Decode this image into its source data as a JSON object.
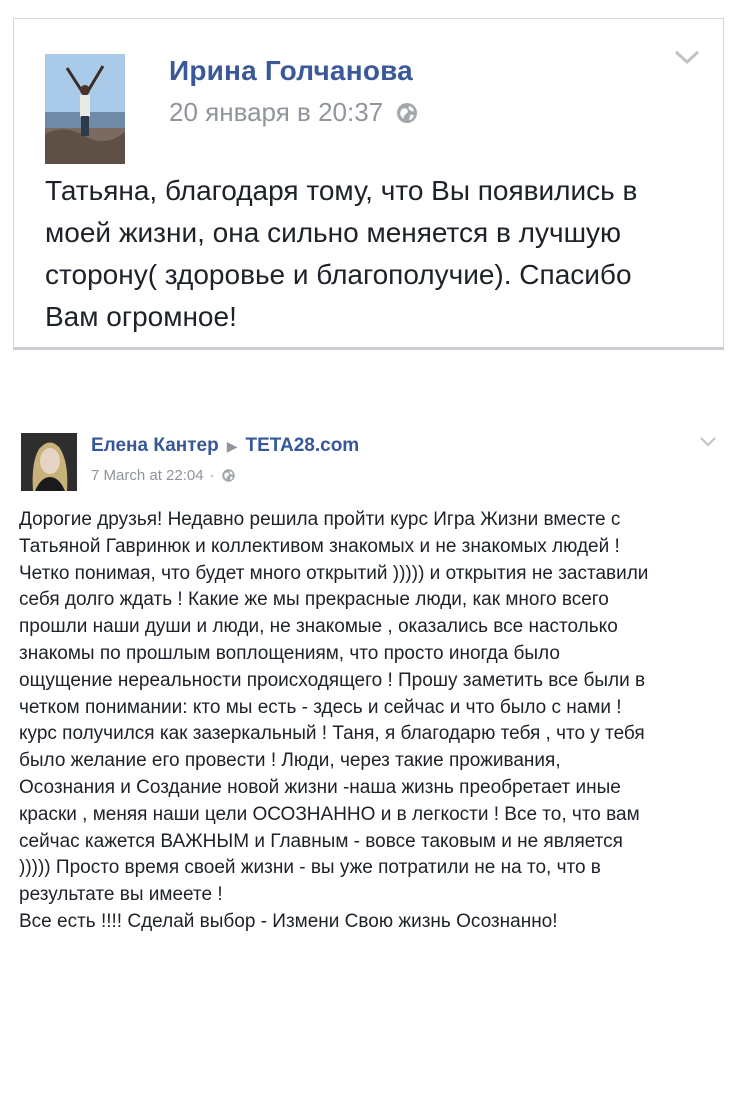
{
  "post1": {
    "author": "Ирина Голчанова",
    "timestamp": "20 января в 20:37",
    "privacy_icon": "globe-icon",
    "menu_icon": "chevron-down-icon",
    "body": "Татьяна, благодаря тому, что Вы появились в\nмоей жизни, она сильно меняется в лучшую\nсторону( здоровье и благополучие). Спасибо\nВам огромное!"
  },
  "post2": {
    "author": "Елена Кантер",
    "separator": "▶",
    "target": "TETA28.com",
    "timestamp": "7 March at 22:04",
    "dot": "·",
    "privacy_icon": "globe-icon",
    "menu_icon": "chevron-down-icon",
    "body": "Дорогие друзья! Недавно решила пройти курс Игра Жизни вместе с\nТатьяной Гавринюк и коллективом знакомых и не знакомых людей !\nЧетко понимая, что будет много открытий ))))) и открытия не заставили\nсебя долго ждать ! Какие же мы прекрасные люди, как много всего\nпрошли наши души и люди, не знакомые , оказались все настолько\nзнакомы по прошлым воплощениям, что просто иногда было\nощущение нереальности происходящего ! Прошу заметить все были в\nчетком понимании: кто мы есть - здесь и сейчас и что было с нами !\nкурс получился как зазеркальный ! Таня, я благодарю тебя , что у тебя\nбыло желание его провести ! Люди, через такие проживания,\nОсознания и Создание новой жизни -наша жизнь преобретает иные\nкраски , меняя наши цели ОСОЗНАННО и в легкости ! Все то, что вам\nсейчас кажется ВАЖНЫМ и Главным - вовсе таковым и не является\n))))) Просто время своей жизни - вы уже потратили не на то, что в\nрезультате вы имеете !\nВсе есть !!!! Сделай выбор - Измени Свою жизнь Осознанно!"
  },
  "colors": {
    "link": "#3b5998",
    "meta": "#90949c",
    "text": "#1d2129",
    "border": "#d3d6db"
  }
}
